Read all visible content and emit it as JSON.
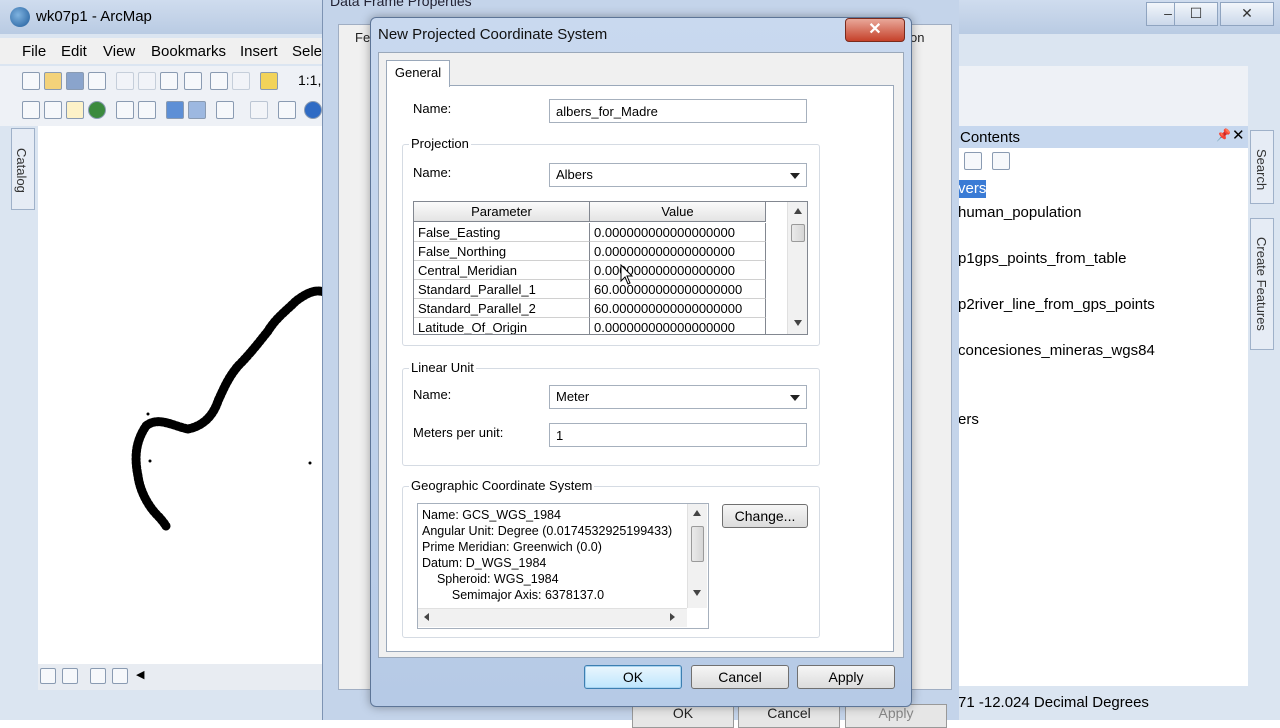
{
  "app": {
    "title": "wk07p1 - ArcMap",
    "menu": [
      "File",
      "Edit",
      "View",
      "Bookmarks",
      "Insert",
      "Sele"
    ],
    "scale_text": "1:1,",
    "window_controls": [
      "–",
      "☐",
      "✕"
    ]
  },
  "catalog_tab": "Catalog",
  "toc": {
    "title": "Contents",
    "layers_label": "vers",
    "items": [
      "human_population",
      "p1gps_points_from_table",
      "p2river_line_from_gps_points",
      "concesiones_mineras_wgs84",
      "ers"
    ]
  },
  "right_tabs": [
    "Search",
    "Create Features"
  ],
  "status": {
    "coordinates": "71  -12.024 Decimal Degrees"
  },
  "data_frame_properties": {
    "title": "Data Frame Properties",
    "tab_partial": "Fe",
    "tab_right": "on",
    "ok": "OK",
    "cancel": "Cancel",
    "apply": "Apply"
  },
  "dialog": {
    "title": "New Projected Coordinate System",
    "close": "✕",
    "tab": "General",
    "name_label": "Name:",
    "name_value": "albers_for_Madre",
    "projection": {
      "group": "Projection",
      "name_label": "Name:",
      "name_value": "Albers",
      "columns": [
        "Parameter",
        "Value"
      ],
      "rows": [
        {
          "param": "False_Easting",
          "value": "0.000000000000000000"
        },
        {
          "param": "False_Northing",
          "value": "0.000000000000000000"
        },
        {
          "param": "Central_Meridian",
          "value": "0.000000000000000000"
        },
        {
          "param": "Standard_Parallel_1",
          "value": "60.000000000000000000"
        },
        {
          "param": "Standard_Parallel_2",
          "value": "60.000000000000000000"
        },
        {
          "param": "Latitude_Of_Origin",
          "value": "0.000000000000000000"
        }
      ]
    },
    "linear_unit": {
      "group": "Linear Unit",
      "name_label": "Name:",
      "name_value": "Meter",
      "meters_label": "Meters per unit:",
      "meters_value": "1"
    },
    "gcs": {
      "group": "Geographic Coordinate System",
      "lines": [
        "Name: GCS_WGS_1984",
        "Angular Unit: Degree (0.0174532925199433)",
        "Prime Meridian: Greenwich (0.0)",
        "Datum: D_WGS_1984",
        "  Spheroid: WGS_1984",
        "    Semimajor Axis: 6378137.0"
      ],
      "change_button": "Change..."
    },
    "buttons": {
      "ok": "OK",
      "cancel": "Cancel",
      "apply": "Apply"
    }
  }
}
